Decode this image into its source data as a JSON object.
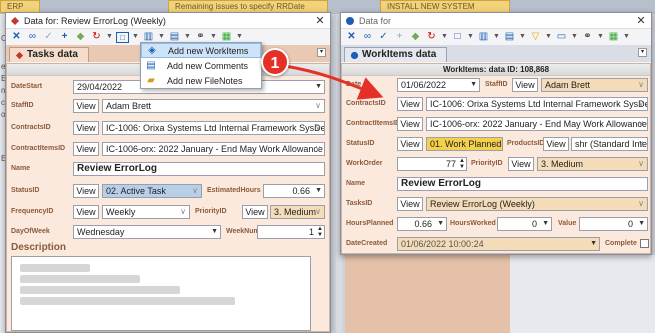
{
  "background": {
    "tabs": [
      "ERP",
      "Remaining issues to specify RRDate",
      "INSTALL NEW SYSTEM"
    ],
    "left_snippets": [
      "Op",
      "ex",
      "Est",
      "nr",
      "ct",
      "ope",
      "Est"
    ]
  },
  "left_window": {
    "title": "Data for: Review ErrorLog (Weekly)",
    "tab_label": "Tasks data",
    "header": "Tasks",
    "fields": {
      "datestart": {
        "label": "DateStart",
        "value": "29/04/2022"
      },
      "staffid": {
        "label": "StaffID",
        "view": "View",
        "value": "Adam Brett"
      },
      "contractsid": {
        "label": "ContractsID",
        "view": "View",
        "value": "IC-1006: Orixa Systems Ltd Internal Framework SysDev"
      },
      "contractitemsid": {
        "label": "ContractItemsID",
        "view": "View",
        "value": "IC-1006-orx: 2022 January - End May Work Allowance Non-charg"
      },
      "name": {
        "label": "Name",
        "value": "Review ErrorLog"
      },
      "statusid": {
        "label": "StatusID",
        "view": "View",
        "value": "02. Active Task"
      },
      "estimatedhours": {
        "label": "EstimatedHours",
        "value": "0.66"
      },
      "frequencyid": {
        "label": "FrequencyID",
        "view": "View",
        "value": "Weekly"
      },
      "priorityid": {
        "label": "PriorityID",
        "view": "View",
        "value": "3. Medium"
      },
      "dayofweek": {
        "label": "DayOfWeek",
        "value": "Wednesday"
      },
      "weeknum": {
        "label": "WeekNum",
        "value": "1"
      }
    },
    "description_label": "Description"
  },
  "menu": {
    "items": [
      {
        "label": "Add new WorkItems",
        "icon": "workitems-icon"
      },
      {
        "label": "Add new Comments",
        "icon": "comments-icon"
      },
      {
        "label": "Add new FileNotes",
        "icon": "filenotes-icon"
      }
    ]
  },
  "annotation": {
    "number": "1",
    "color": "#e53028"
  },
  "right_window": {
    "title": "Data for",
    "tab_label": "WorkItems data",
    "header": "WorkItems: data ID: 108,868",
    "fields": {
      "date": {
        "label": "Date",
        "value": "01/06/2022"
      },
      "staffid": {
        "label": "StaffID",
        "view": "View",
        "value": "Adam Brett"
      },
      "contractsid": {
        "label": "ContractsID",
        "view": "View",
        "value": "IC-1006: Orixa Systems Ltd Internal Framework SysDev"
      },
      "contractitemsid": {
        "label": "ContractItemsID",
        "view": "View",
        "value": "IC-1006-orx: 2022 January - End May Work Allowance Non-charg"
      },
      "statusid": {
        "label": "StatusID",
        "view": "View",
        "value": "01. Work Planned"
      },
      "productsid": {
        "label": "ProductsID",
        "view": "View",
        "value": "shr (Standard Interna"
      },
      "workorder": {
        "label": "WorkOrder",
        "value": "77"
      },
      "priorityid": {
        "label": "PriorityID",
        "view": "View",
        "value": "3. Medium"
      },
      "name": {
        "label": "Name",
        "value": "Review ErrorLog"
      },
      "tasksid": {
        "label": "TasksID",
        "view": "View",
        "value": "Review ErrorLog (Weekly)"
      },
      "hoursplanned": {
        "label": "HoursPlanned",
        "value": "0.66"
      },
      "hoursworked": {
        "label": "HoursWorked",
        "value": "0"
      },
      "value": {
        "label": "Value",
        "value": "0"
      },
      "datecreated": {
        "label": "DateCreated",
        "value": "01/06/2022 10:00:24"
      },
      "complete": {
        "label": "Complete"
      }
    }
  }
}
